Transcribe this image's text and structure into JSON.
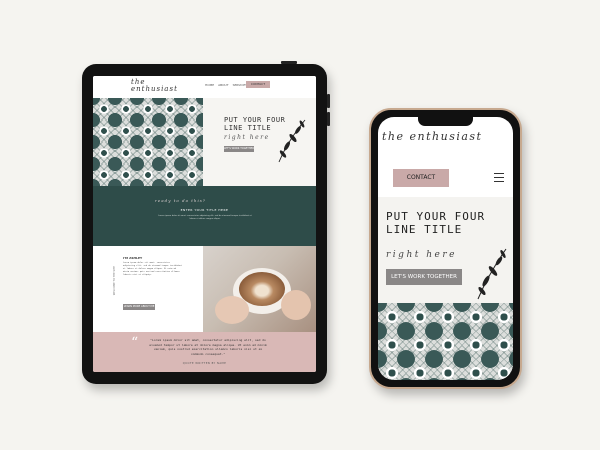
{
  "tablet": {
    "logo": "the enthusiast",
    "nav": [
      "HOME",
      "ABOUT",
      "SERVICES",
      "BLOG"
    ],
    "contact": "CONTACT",
    "hero_title": "PUT YOUR FOUR LINE TITLE",
    "hero_script": "right here",
    "hero_button": "LET'S WORK TOGETHER",
    "green_script": "ready to do this?",
    "green_heading": "ENTER YOUR TITLE HERE",
    "green_body": "Lorem ipsum dolor sit amet, consectetur adipiscing elit, sed do eiusmod tempor incididunt ut labore et dolore magna aliqua.",
    "about_heading": "I'M ASHLEY",
    "about_body": "Lorem ipsum dolor sit amet, consectetur adipiscing elit, sed do eiusmod tempor incididunt ut labore et dolore magna aliqua. Ut enim ad minim veniam, quis nostrud exercitation ullamco laboris nisi ut aliquip.",
    "about_button": "LEARN MORE ABOUT ME",
    "about_vertical": "WELCOME TO THE SITE",
    "quote": "\"Lorem ipsum dolor sit amet, consectetur adipiscing elit, sed do eiusmod tempor ut labore et dolore magna aliqua. Ut enim ad minim veniam, quis nostrud exercitation ullamco laboris nisi ut ex commodo consequat.\"",
    "quote_cite": "QUOTE WRITTEN BY NAME"
  },
  "phone": {
    "logo": "the enthusiast",
    "contact": "CONTACT",
    "hero_title": "PUT YOUR FOUR LINE TITLE",
    "hero_script": "right here",
    "hero_button": "LET'S WORK TOGETHER"
  },
  "colors": {
    "background": "#f5f4f0",
    "green": "#2e4c49",
    "pink": "#d9b8b6",
    "button_gray": "#8a8787",
    "phone_frame": "#c7a98f"
  }
}
